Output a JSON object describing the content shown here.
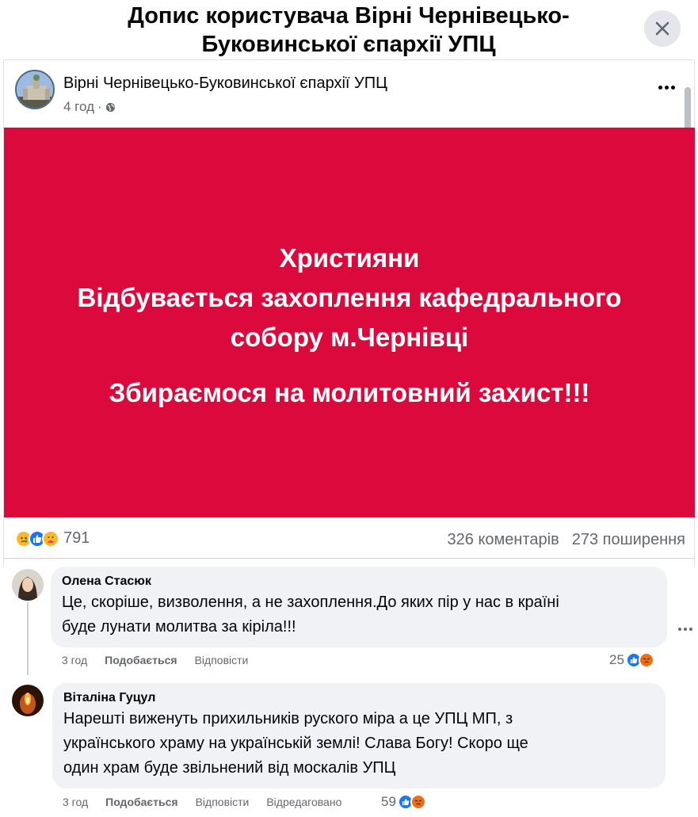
{
  "dialog": {
    "title": "Допис користувача Вірні Чернівецько-Буковинської єпархії УПЦ",
    "close_icon": "close-icon"
  },
  "post": {
    "page_name": "Вірні Чернівецько-Буковинської єпархії УПЦ",
    "time": "4 год",
    "privacy_icon": "globe-icon",
    "image_text": {
      "line1": "Християни",
      "line2": "Відбувається захоплення кафедрального",
      "line3": "собору м.Чернівці",
      "line4": "Збираємося на молитовний захист!!!"
    },
    "image_bg": "#dc0a3c",
    "reaction_count": "791",
    "comments_count": "326 коментарів",
    "shares_count": "273 поширення"
  },
  "comments": [
    {
      "author": "Олена Стасюк",
      "text_line1": "Це, скоріше, визволення, а не захоплення.До яких пір у нас в країні",
      "text_line2": "буде лунати молитва за кіріла!!!",
      "time": "3 год",
      "like_label": "Подобається",
      "reply_label": "Відповісти",
      "reaction_count": "25"
    },
    {
      "author": "Віталіна Гуцул",
      "text_line1": "Нарешті виженуть прихильників руского міра а це УПЦ МП, з",
      "text_line2": "українського храму на українській землі! Слава Богу! Скоро ще",
      "text_line3": "один храм буде звільнений від москалів УПЦ",
      "time": "3 год",
      "like_label": "Подобається",
      "reply_label": "Відповісти",
      "edited_label": "Відредаговано",
      "reaction_count": "59"
    }
  ],
  "colors": {
    "accent": "#1877f2",
    "secondary_text": "#65676b",
    "bubble_bg": "#f0f2f5"
  }
}
